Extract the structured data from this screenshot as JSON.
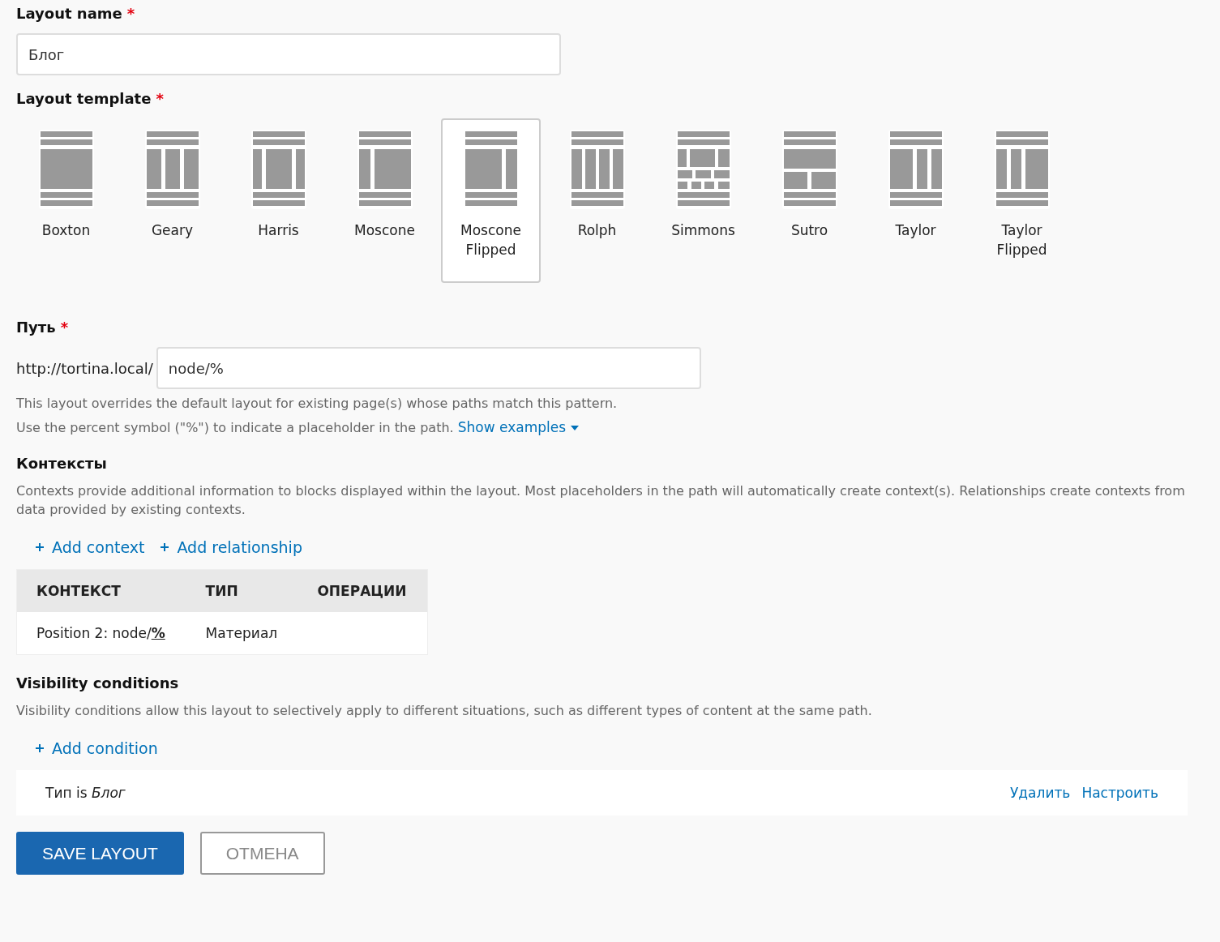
{
  "layout_name": {
    "label": "Layout name",
    "required_marker": "*",
    "value": "Блог"
  },
  "layout_template": {
    "label": "Layout template",
    "required_marker": "*",
    "templates": [
      {
        "name": "Boxton",
        "kind": "boxton",
        "selected": false
      },
      {
        "name": "Geary",
        "kind": "geary",
        "selected": false
      },
      {
        "name": "Harris",
        "kind": "harris",
        "selected": false
      },
      {
        "name": "Moscone",
        "kind": "moscone",
        "selected": false
      },
      {
        "name": "Moscone Flipped",
        "kind": "moscone-flipped",
        "selected": true
      },
      {
        "name": "Rolph",
        "kind": "rolph",
        "selected": false
      },
      {
        "name": "Simmons",
        "kind": "simmons",
        "selected": false
      },
      {
        "name": "Sutro",
        "kind": "sutro",
        "selected": false
      },
      {
        "name": "Taylor",
        "kind": "taylor",
        "selected": false
      },
      {
        "name": "Taylor Flipped",
        "kind": "taylor-flipped",
        "selected": false
      }
    ]
  },
  "path": {
    "label": "Путь",
    "required_marker": "*",
    "prefix": "http://tortina.local/",
    "value": "node/%",
    "help": [
      "This layout overrides the default layout for existing page(s) whose paths match this pattern.",
      "Use the percent symbol (\"%\") to indicate a placeholder in the path."
    ],
    "show_examples": "Show examples"
  },
  "contexts": {
    "title": "Контексты",
    "description": "Contexts provide additional information to blocks displayed within the layout. Most placeholders in the path will automatically create context(s). Relationships create contexts from data provided by existing contexts.",
    "actions": [
      "Add context",
      "Add relationship"
    ],
    "table": {
      "columns": [
        "КОНТЕКСТ",
        "ТИП",
        "ОПЕРАЦИИ"
      ],
      "rows": [
        [
          "Position 2: node/**%**",
          "Материал",
          ""
        ]
      ]
    }
  },
  "visibility": {
    "title": "Visibility conditions",
    "description": "Visibility conditions allow this layout to selectively apply to different situations, such as different types of content at the same path.",
    "actions": [
      "Add condition"
    ],
    "conditions": [
      {
        "text": "Тип is *Блог*",
        "links": [
          "Удалить",
          "Настроить"
        ]
      }
    ]
  },
  "buttons": [
    {
      "label": "SAVE LAYOUT",
      "kind": "primary"
    },
    {
      "label": "ОТМЕНА",
      "kind": "secondary"
    }
  ]
}
